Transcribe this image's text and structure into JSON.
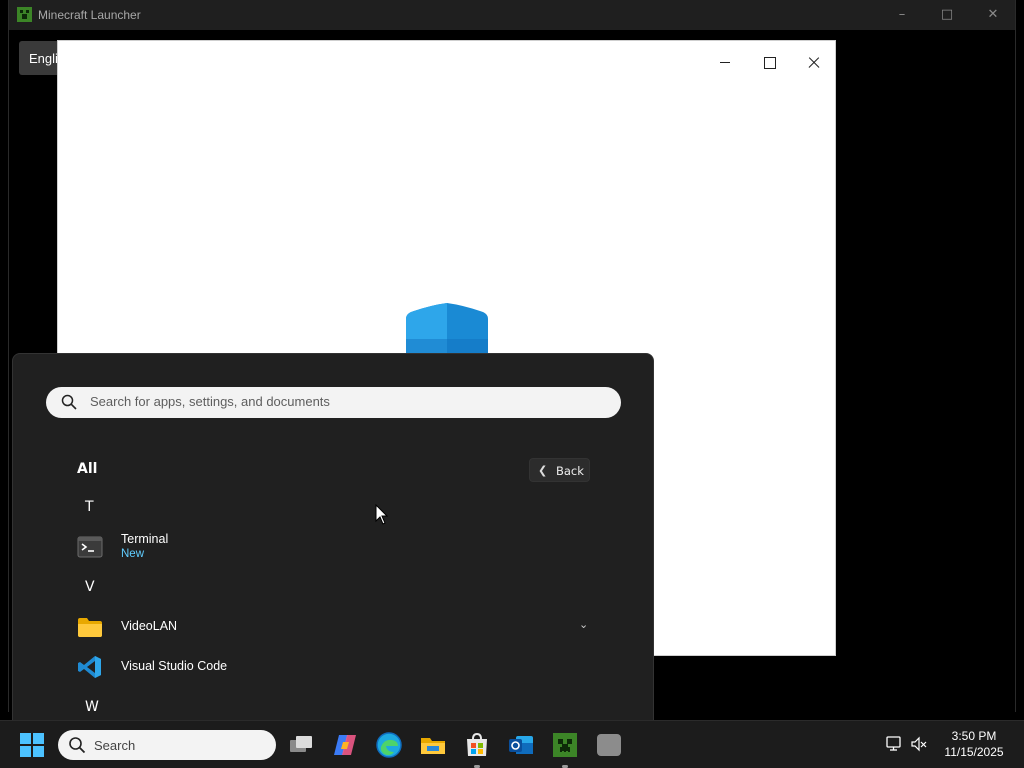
{
  "launcher": {
    "title": "Minecraft Launcher",
    "language_button": "English",
    "side_glyph": "V"
  },
  "start_menu": {
    "search_placeholder": "Search for apps, settings, and documents",
    "section_label": "All",
    "back_label": "Back",
    "groups": [
      {
        "letter": "T",
        "apps": [
          {
            "name": "Terminal",
            "badge": "New",
            "icon": "terminal-icon"
          }
        ]
      },
      {
        "letter": "V",
        "apps": [
          {
            "name": "VideoLAN",
            "icon": "folder-icon",
            "expandable": true
          },
          {
            "name": "Visual Studio Code",
            "icon": "vscode-icon"
          }
        ]
      },
      {
        "letter": "W",
        "apps": []
      }
    ]
  },
  "taskbar": {
    "search_label": "Search",
    "apps": [
      "task-view-icon",
      "copilot-icon",
      "edge-icon",
      "file-explorer-icon",
      "microsoft-store-icon",
      "outlook-icon",
      "minecraft-icon",
      "blank-app-icon"
    ],
    "clock": {
      "time": "3:50 PM",
      "date": "11/15/2025"
    }
  },
  "colors": {
    "accent": "#4cc2ff",
    "badge_new": "#60cdff",
    "start_menu_bg": "#202020",
    "taskbar_bg": "#1c1c1c"
  }
}
